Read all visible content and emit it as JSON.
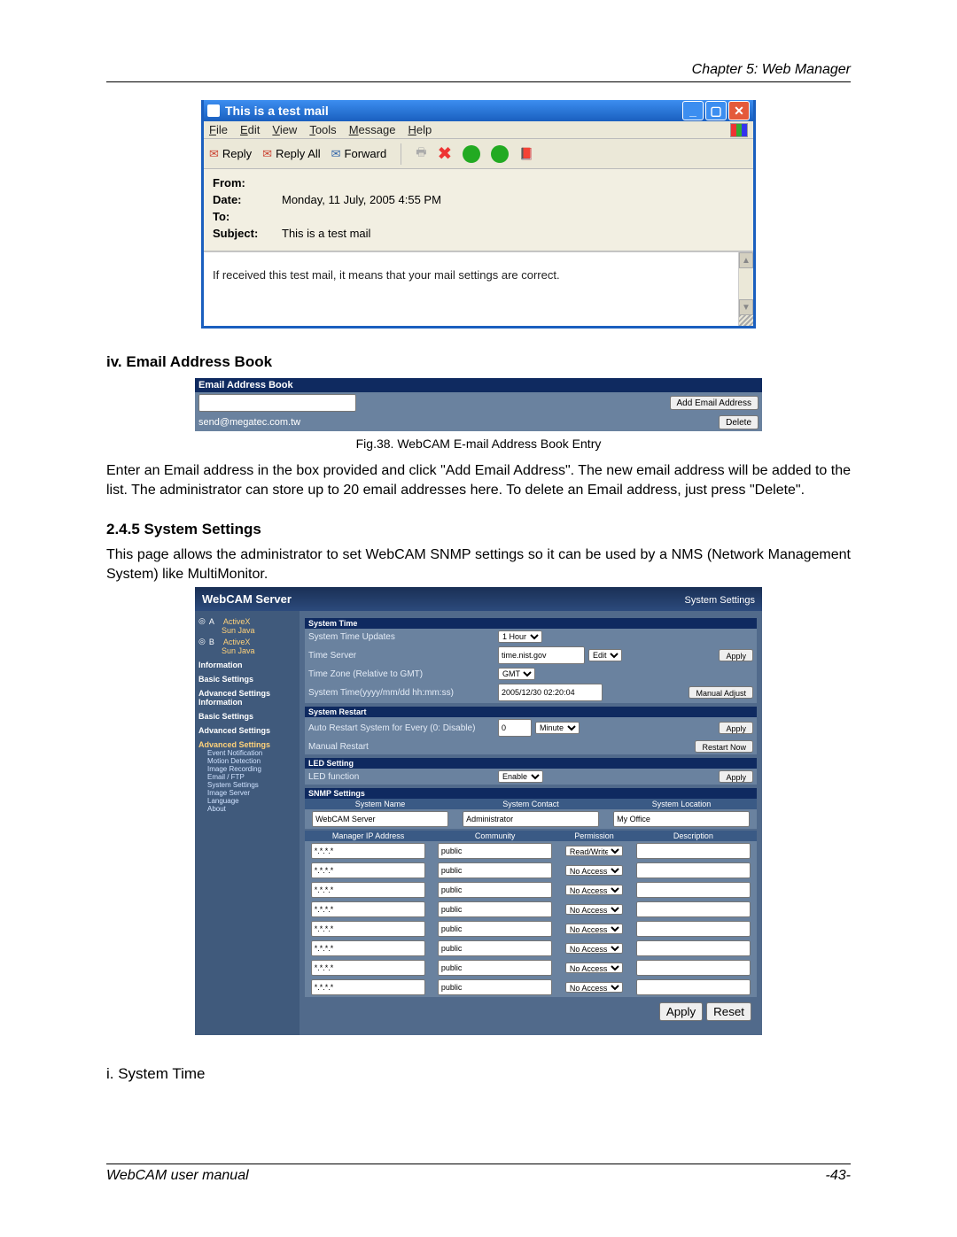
{
  "chapter_header": "Chapter 5: Web Manager",
  "footer_left": "WebCAM user manual",
  "footer_right": "-43-",
  "mailwin": {
    "title": "This is a test mail",
    "menu": {
      "file": "File",
      "edit": "Edit",
      "view": "View",
      "tools": "Tools",
      "message": "Message",
      "help": "Help"
    },
    "tb": {
      "reply": "Reply",
      "replyall": "Reply All",
      "forward": "Forward"
    },
    "hdr": {
      "from_l": "From:",
      "from_v": "",
      "date_l": "Date:",
      "date_v": "Monday, 11 July, 2005 4:55 PM",
      "to_l": "To:",
      "to_v": "",
      "subj_l": "Subject:",
      "subj_v": "This is a test mail"
    },
    "body": "If received this test mail, it means that your mail settings are correct."
  },
  "sec_iv": "iv.   Email Address Book",
  "eab": {
    "header": "Email Address Book",
    "input_value": "",
    "add_btn": "Add Email Address",
    "list_item": "send@megatec.com.tw",
    "del_btn": "Delete"
  },
  "fig38": "Fig.38.  WebCAM E-mail Address Book Entry",
  "para_eab": "Enter an Email address in the box provided and click \"Add Email Address\".   The new email address will be added to the list.   The administrator can store up to 20 email addresses here.   To delete an Email address, just press \"Delete\".",
  "sec_245": "2.4.5 System Settings",
  "para_245": "This page allows the administrator to set WebCAM SNMP settings so it can be used by a NMS (Network Management System) like MultiMonitor.",
  "wcs": {
    "brand": "WebCAM Server",
    "crumb": "System Settings",
    "side": {
      "a": "A",
      "b": "B",
      "activex": "ActiveX",
      "sunjava": "Sun Java",
      "info": "Information",
      "basic": "Basic Settings",
      "advinfo": "Advanced Settings Information",
      "basic2": "Basic Settings",
      "adv": "Advanced Settings",
      "adv2": "Advanced Settings",
      "items": [
        "Event Notification",
        "Motion Detection",
        "Image Recording",
        "Email / FTP",
        "System Settings",
        "Image Server",
        "Language",
        "About"
      ]
    },
    "systime": {
      "hdr": "System Time",
      "l1": "System Time Updates",
      "v1": "1 Hour",
      "l2": "Time Server",
      "v2": "time.nist.gov",
      "edit": "Edit",
      "l3": "Time Zone (Relative to GMT)",
      "v3": "GMT",
      "l4": "System Time(yyyy/mm/dd hh:mm:ss)",
      "v4": "2005/12/30 02:20:04",
      "apply": "Apply",
      "manual": "Manual Adjust"
    },
    "restart": {
      "hdr": "System Restart",
      "l1": "Auto Restart System for Every (0: Disable)",
      "v1": "0",
      "unit": "Minute",
      "apply": "Apply",
      "l2": "Manual Restart",
      "btn": "Restart Now"
    },
    "led": {
      "hdr": "LED Setting",
      "l1": "LED function",
      "v1": "Enable",
      "apply": "Apply"
    },
    "snmp": {
      "hdr": "SNMP Settings",
      "h_sysname": "System Name",
      "h_contact": "System Contact",
      "h_loc": "System Location",
      "v_sysname": "WebCAM Server",
      "v_contact": "Administrator",
      "v_loc": "My Office",
      "cols": [
        "Manager IP Address",
        "Community",
        "Permission",
        "Description"
      ],
      "rows": [
        {
          "ip": "*.*.*.*",
          "comm": "public",
          "perm": "Read/Write",
          "desc": ""
        },
        {
          "ip": "*.*.*.*",
          "comm": "public",
          "perm": "No Access",
          "desc": ""
        },
        {
          "ip": "*.*.*.*",
          "comm": "public",
          "perm": "No Access",
          "desc": ""
        },
        {
          "ip": "*.*.*.*",
          "comm": "public",
          "perm": "No Access",
          "desc": ""
        },
        {
          "ip": "*.*.*.*",
          "comm": "public",
          "perm": "No Access",
          "desc": ""
        },
        {
          "ip": "*.*.*.*",
          "comm": "public",
          "perm": "No Access",
          "desc": ""
        },
        {
          "ip": "*.*.*.*",
          "comm": "public",
          "perm": "No Access",
          "desc": ""
        },
        {
          "ip": "*.*.*.*",
          "comm": "public",
          "perm": "No Access",
          "desc": ""
        }
      ],
      "apply": "Apply",
      "reset": "Reset"
    }
  },
  "sec_i": "i.     System Time"
}
